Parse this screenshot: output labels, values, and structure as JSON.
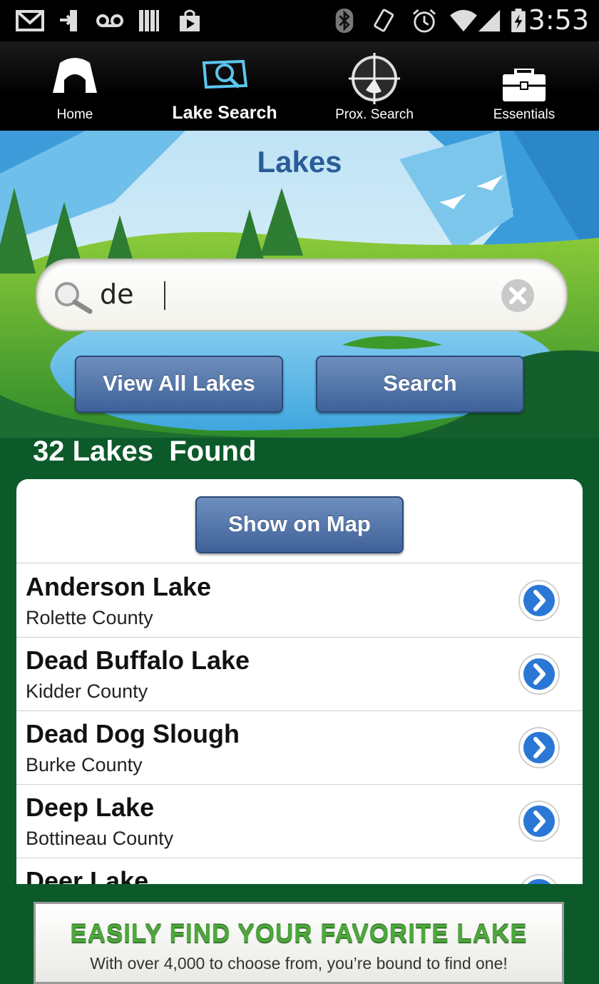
{
  "status_bar": {
    "time": "3:53",
    "icons": [
      "gmail-icon",
      "download-icon",
      "voicemail-icon",
      "signal-bars-icon",
      "play-store-icon",
      "bluetooth-icon",
      "rotate-icon",
      "alarm-icon",
      "wifi-icon",
      "cell-signal-icon",
      "battery-icon"
    ]
  },
  "nav": {
    "items": [
      {
        "label": "Home",
        "icon": "tent-icon"
      },
      {
        "label": "Lake Search",
        "icon": "lake-search-icon"
      },
      {
        "label": "Prox. Search",
        "icon": "crosshair-icon"
      },
      {
        "label": "Essentials",
        "icon": "toolbox-icon"
      }
    ],
    "active_index": 1
  },
  "page": {
    "title": "Lakes"
  },
  "search": {
    "value": "de",
    "placeholder": ""
  },
  "buttons": {
    "view_all": "View All Lakes",
    "search": "Search",
    "show_on_map": "Show on Map"
  },
  "results": {
    "count_text": "32 Lakes  Found",
    "items": [
      {
        "name": "Anderson Lake",
        "county": "Rolette County"
      },
      {
        "name": "Dead Buffalo Lake",
        "county": "Kidder County"
      },
      {
        "name": "Dead Dog Slough",
        "county": "Burke County"
      },
      {
        "name": "Deep Lake",
        "county": "Bottineau County"
      },
      {
        "name": "Deer Lake",
        "county": ""
      }
    ]
  },
  "banner": {
    "title": "EASILY FIND YOUR FAVORITE LAKE",
    "subtitle": "With over 4,000 to choose from, you’re bound to find one!"
  },
  "colors": {
    "accent_blue": "#2a5d97",
    "button_blue": "#4d6fa6",
    "forest_green": "#0c5a2a",
    "banner_green": "#4ca93b"
  }
}
